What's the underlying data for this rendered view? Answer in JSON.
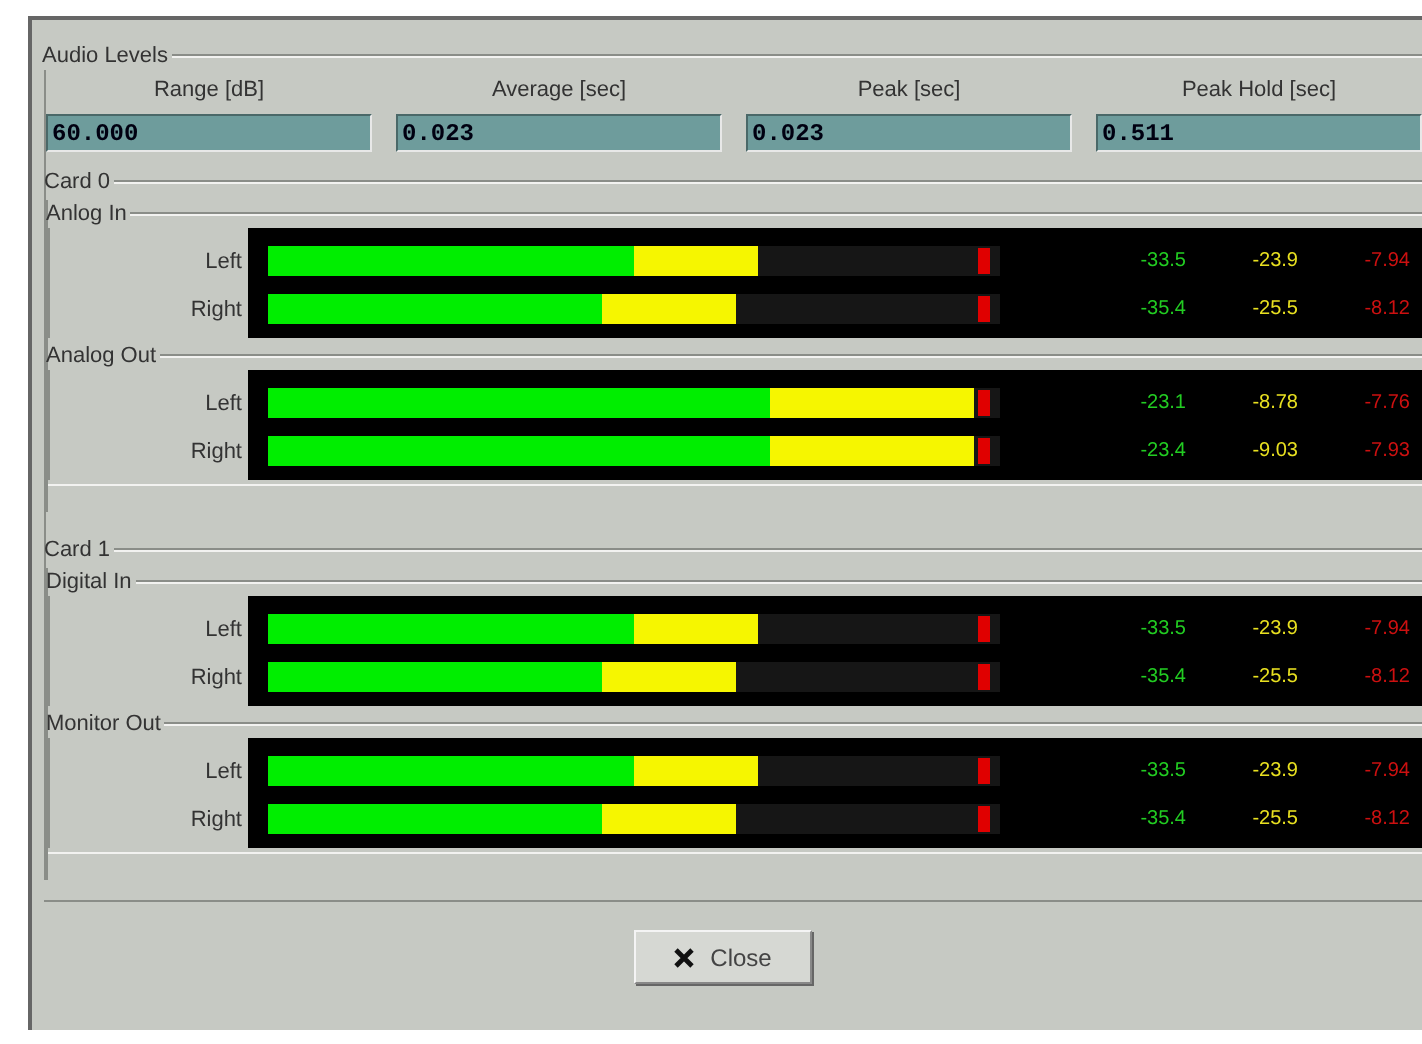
{
  "panel": {
    "title": "Audio Levels"
  },
  "settings": [
    {
      "label": "Range [dB]",
      "value": "60.000"
    },
    {
      "label": "Average [sec]",
      "value": "0.023"
    },
    {
      "label": "Peak [sec]",
      "value": "0.023"
    },
    {
      "label": "Peak Hold [sec]",
      "value": "0.511"
    }
  ],
  "cards": [
    {
      "title": "Card 0",
      "groups": [
        {
          "title": "Anlog In",
          "channels": [
            {
              "name": "Left",
              "average": {
                "level": 0.5
              },
              "peak": {
                "level": 0.67
              },
              "hold": {
                "level": 0.985
              },
              "readings": [
                "-33.5",
                "-23.9",
                "-7.94"
              ]
            },
            {
              "name": "Right",
              "average": {
                "level": 0.455
              },
              "peak": {
                "level": 0.64
              },
              "hold": {
                "level": 0.985
              },
              "readings": [
                "-35.4",
                "-25.5",
                "-8.12"
              ]
            }
          ]
        },
        {
          "title": "Analog Out",
          "channels": [
            {
              "name": "Left",
              "average": {
                "level": 0.685
              },
              "peak": {
                "level": 0.965
              },
              "hold": {
                "level": 0.985
              },
              "readings": [
                "-23.1",
                "-8.78",
                "-7.76"
              ]
            },
            {
              "name": "Right",
              "average": {
                "level": 0.685
              },
              "peak": {
                "level": 0.965
              },
              "hold": {
                "level": 0.985
              },
              "readings": [
                "-23.4",
                "-9.03",
                "-7.93"
              ]
            }
          ]
        }
      ]
    },
    {
      "title": "Card 1",
      "groups": [
        {
          "title": "Digital In",
          "channels": [
            {
              "name": "Left",
              "average": {
                "level": 0.5
              },
              "peak": {
                "level": 0.67
              },
              "hold": {
                "level": 0.985
              },
              "readings": [
                "-33.5",
                "-23.9",
                "-7.94"
              ]
            },
            {
              "name": "Right",
              "average": {
                "level": 0.455
              },
              "peak": {
                "level": 0.64
              },
              "hold": {
                "level": 0.985
              },
              "readings": [
                "-35.4",
                "-25.5",
                "-8.12"
              ]
            }
          ]
        },
        {
          "title": "Monitor Out",
          "channels": [
            {
              "name": "Left",
              "average": {
                "level": 0.5
              },
              "peak": {
                "level": 0.67
              },
              "hold": {
                "level": 0.985
              },
              "readings": [
                "-33.5",
                "-23.9",
                "-7.94"
              ]
            },
            {
              "name": "Right",
              "average": {
                "level": 0.455
              },
              "peak": {
                "level": 0.64
              },
              "hold": {
                "level": 0.985
              },
              "readings": [
                "-35.4",
                "-25.5",
                "-8.12"
              ]
            }
          ]
        }
      ]
    }
  ],
  "close_button": {
    "label": "Close"
  }
}
